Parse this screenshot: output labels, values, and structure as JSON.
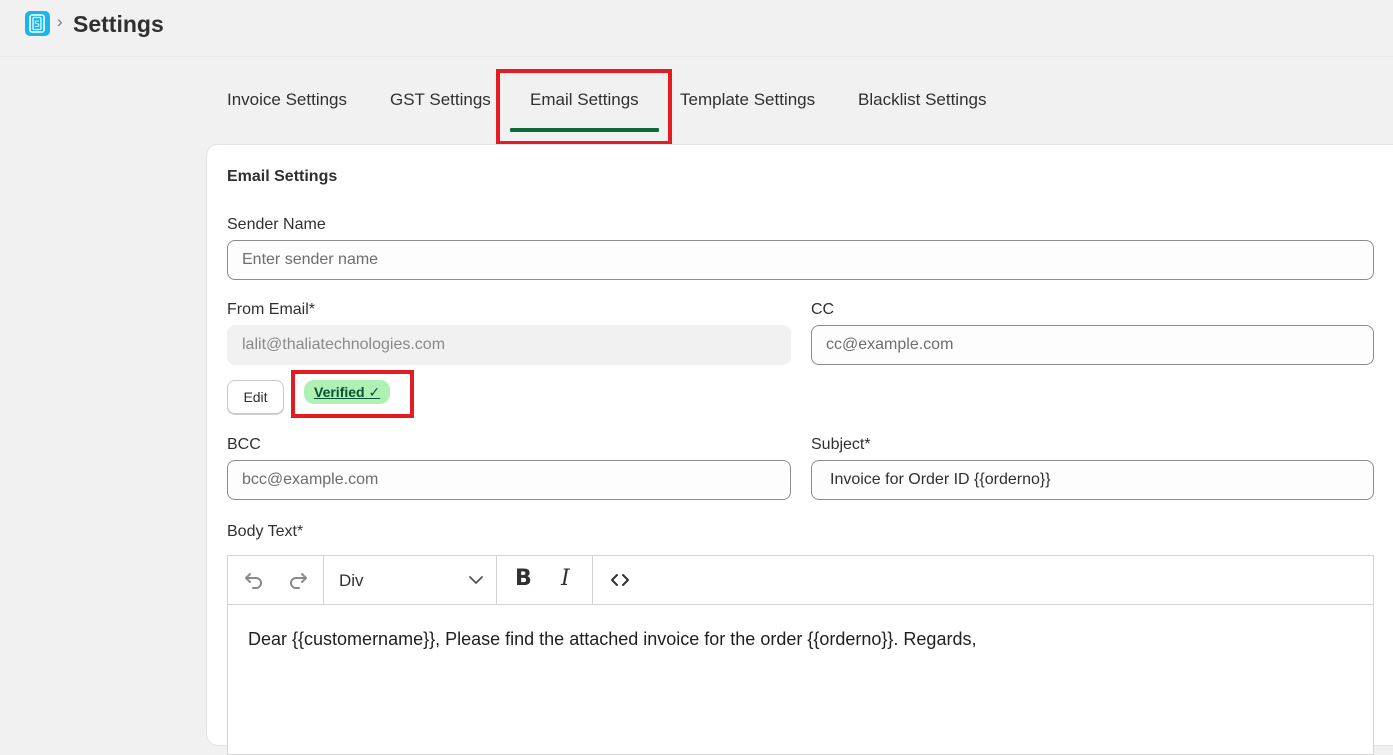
{
  "header": {
    "title": "Settings",
    "breadcrumb_separator": "›",
    "logo_icon": "app-logo-icon"
  },
  "tabs": [
    {
      "label": "Invoice Settings",
      "active": false
    },
    {
      "label": "GST Settings",
      "active": false
    },
    {
      "label": "Email Settings",
      "active": true
    },
    {
      "label": "Template Settings",
      "active": false
    },
    {
      "label": "Blacklist Settings",
      "active": false
    }
  ],
  "form": {
    "title": "Email Settings",
    "sender_name": {
      "label": "Sender Name",
      "placeholder": "Enter sender name",
      "value": ""
    },
    "from_email": {
      "label": "From Email*",
      "value": "lalit@thaliatechnologies.com"
    },
    "cc": {
      "label": "CC",
      "placeholder": "cc@example.com",
      "value": ""
    },
    "edit_label": "Edit",
    "verified_label": "Verified ✓",
    "bcc": {
      "label": "BCC",
      "placeholder": "bcc@example.com",
      "value": ""
    },
    "subject": {
      "label": "Subject*",
      "value": "Invoice for Order ID {{orderno}}"
    },
    "body": {
      "label": "Body Text*",
      "block_format": "Div",
      "content": "Dear {{customername}}, Please find the attached invoice for the order {{orderno}}. Regards,"
    }
  },
  "colors": {
    "active_tab_underline": "#0c6b35",
    "highlight": "#e31b23",
    "verified_badge_bg": "#aff0b5",
    "logo": "#19b6ec"
  }
}
